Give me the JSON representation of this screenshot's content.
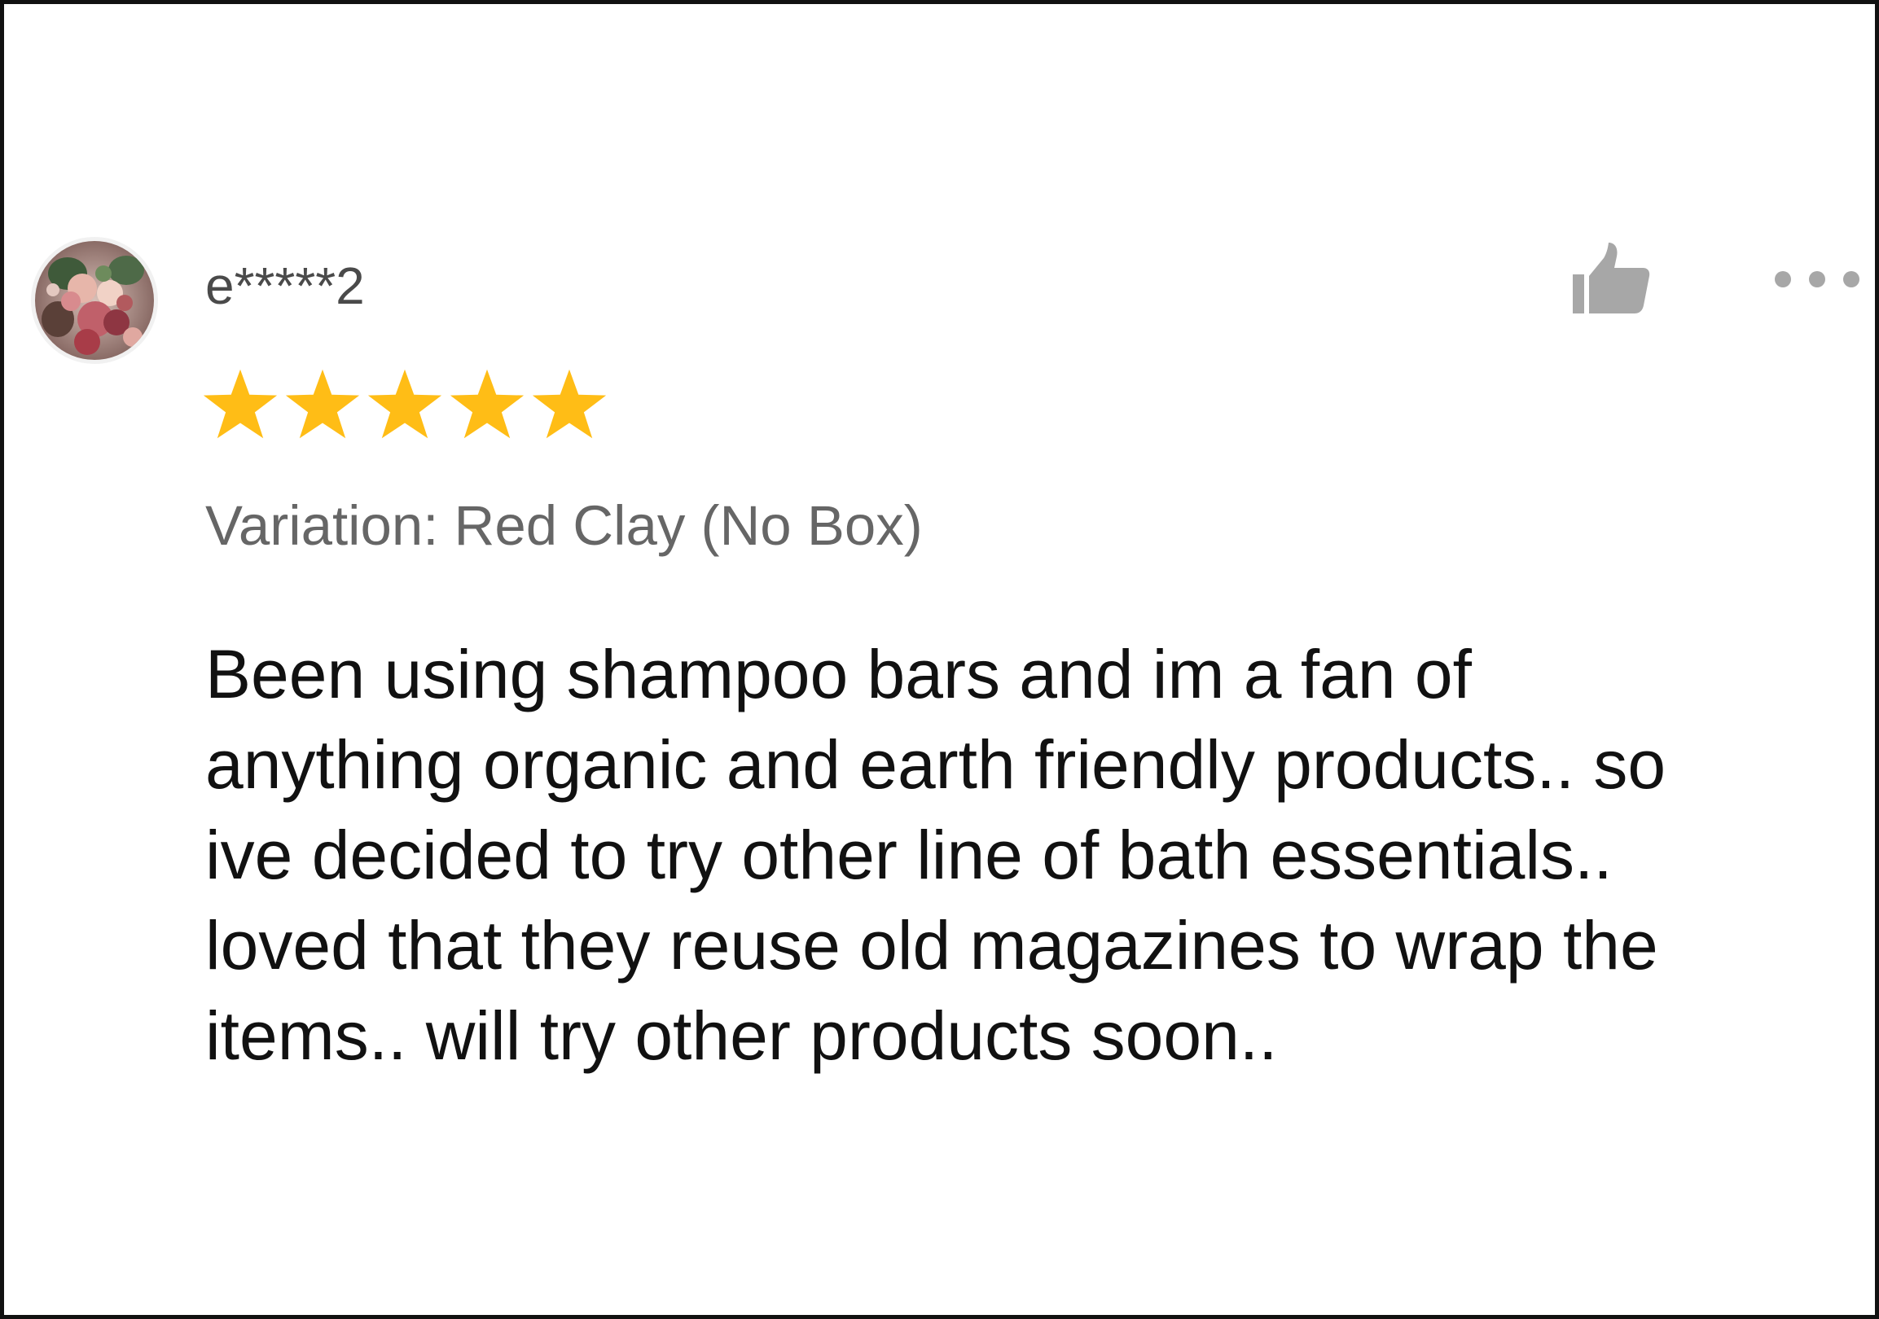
{
  "review": {
    "username": "e*****2",
    "rating": 5,
    "rating_max": 5,
    "variation": "Variation: Red Clay (No Box)",
    "text_lines": [
      "Been using shampoo bars and im a fan of",
      "anything organic and earth friendly products.. so",
      "ive decided to try other line of bath essentials..",
      "loved that they reuse old magazines to wrap the",
      "items.. will try other products soon.."
    ]
  },
  "icons": {
    "avatar": "avatar-floral-photo",
    "like": "thumbs-up-icon",
    "more": "more-dots-icon",
    "star": "star-icon"
  },
  "colors": {
    "star": "#FFBD16",
    "icon_gray": "#A7A7A7",
    "variation_text": "#666666",
    "review_text": "#111111",
    "username_text": "#4A4A4A",
    "frame_border": "#111111"
  }
}
